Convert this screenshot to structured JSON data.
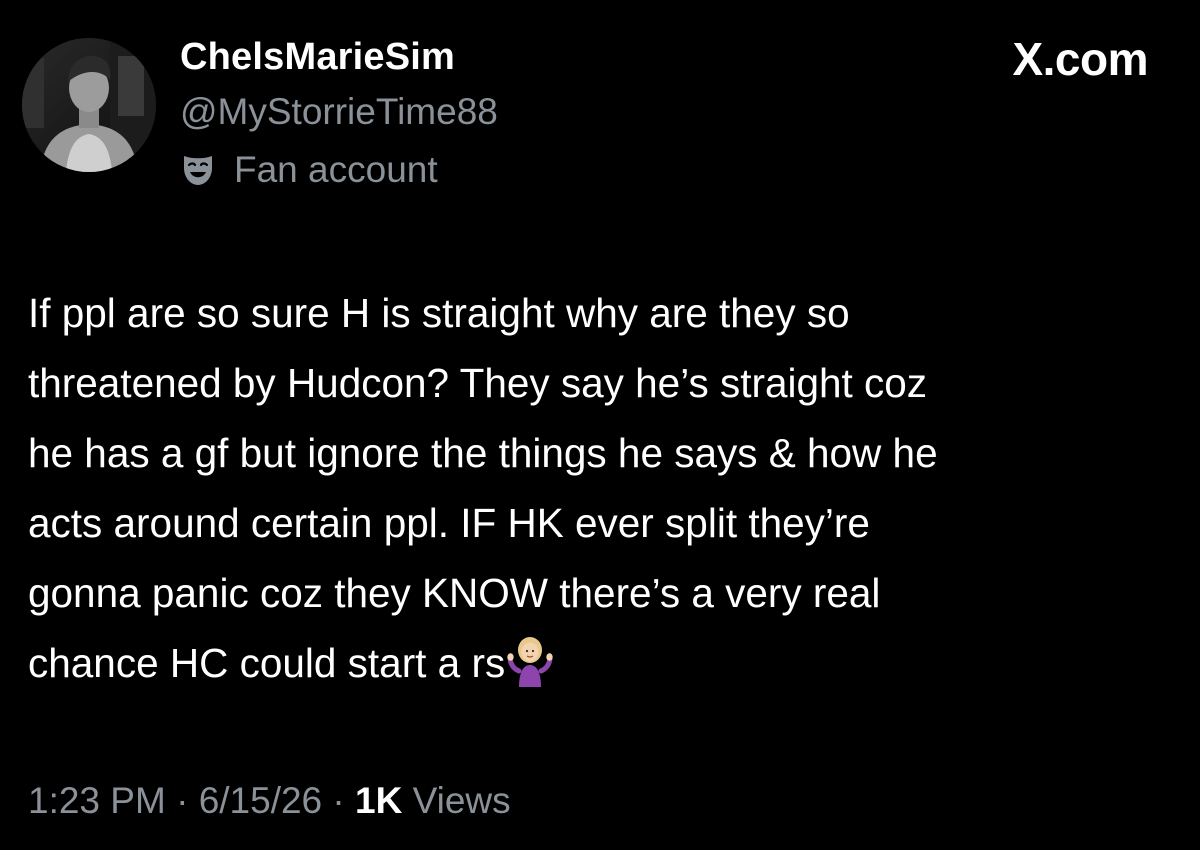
{
  "brand": "X.com",
  "author": {
    "display_name": "ChelsMarieSim",
    "handle": "@MyStorrieTime88",
    "badge_icon": "theater-mask-icon",
    "badge_label": "Fan account"
  },
  "tweet": {
    "lines": [
      "If ppl are so sure H is straight why are they so",
      "threatened by Hudcon? They say he’s straight coz",
      "he has a gf but ignore the things he says & how he",
      "acts around certain ppl. IF HK ever split they’re",
      "gonna panic coz they KNOW there’s a very real",
      "chance HC could start a rs"
    ],
    "trailing_emoji": "🤷🏼‍♀️"
  },
  "meta": {
    "time": "1:23 PM",
    "separator": "·",
    "date": "6/15/26",
    "views_count": "1K",
    "views_label": "Views"
  },
  "colors": {
    "background": "#000000",
    "primary_text": "#ffffff",
    "secondary_text": "#8b9198"
  }
}
